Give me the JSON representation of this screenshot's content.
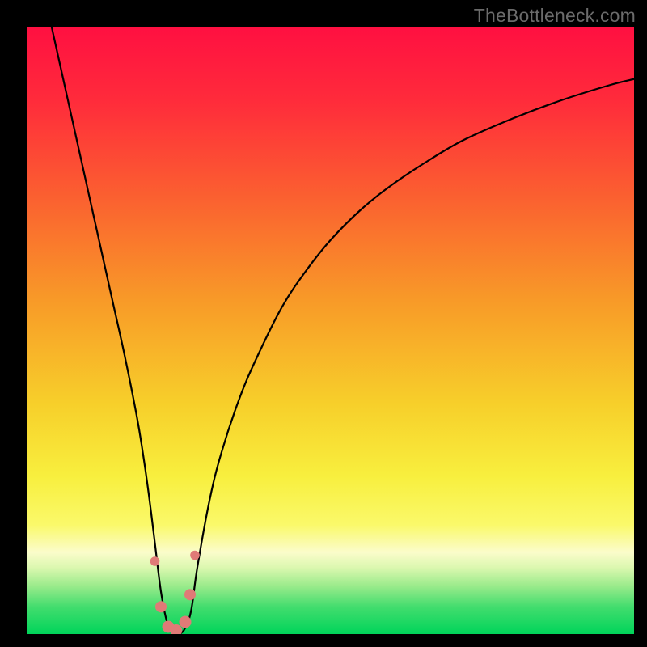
{
  "watermark": "TheBottleneck.com",
  "colors": {
    "frame": "#000000",
    "curve": "#000000",
    "marker_fill": "#e07a77",
    "marker_stroke": "#c45e5b",
    "gradient_stops": [
      {
        "offset": 0.0,
        "color": "#ff1041"
      },
      {
        "offset": 0.12,
        "color": "#ff2b3b"
      },
      {
        "offset": 0.28,
        "color": "#fb6030"
      },
      {
        "offset": 0.45,
        "color": "#f89a28"
      },
      {
        "offset": 0.62,
        "color": "#f7cf2a"
      },
      {
        "offset": 0.74,
        "color": "#f8ef3e"
      },
      {
        "offset": 0.82,
        "color": "#faf96a"
      },
      {
        "offset": 0.865,
        "color": "#fbfccb"
      },
      {
        "offset": 0.89,
        "color": "#dcf8b0"
      },
      {
        "offset": 0.92,
        "color": "#9ceb8c"
      },
      {
        "offset": 0.955,
        "color": "#43dd6e"
      },
      {
        "offset": 1.0,
        "color": "#00d45a"
      }
    ]
  },
  "chart_data": {
    "type": "line",
    "title": "",
    "xlabel": "",
    "ylabel": "",
    "xlim": [
      0,
      100
    ],
    "ylim": [
      0,
      100
    ],
    "grid": false,
    "legend": false,
    "series": [
      {
        "name": "bottleneck-curve",
        "x": [
          4,
          6,
          8,
          10,
          12,
          14,
          16,
          18,
          19,
          20,
          21,
          22,
          23,
          24,
          25,
          26,
          27,
          28,
          30,
          32,
          35,
          38,
          42,
          46,
          50,
          55,
          60,
          66,
          72,
          80,
          88,
          96,
          100
        ],
        "y": [
          100,
          91,
          82,
          73,
          64,
          55,
          46,
          36,
          30,
          23,
          15,
          7,
          2,
          0,
          0,
          1,
          4,
          11,
          22,
          30,
          39,
          46,
          54,
          60,
          65,
          70,
          74,
          78,
          81.5,
          85,
          88,
          90.5,
          91.5
        ]
      }
    ],
    "markers": {
      "name": "highlight-points-near-minimum",
      "x": [
        21.0,
        22.0,
        23.2,
        24.5,
        26.0,
        26.8,
        27.6
      ],
      "y": [
        12.0,
        4.5,
        1.2,
        0.6,
        2.0,
        6.5,
        13.0
      ],
      "r": [
        5.8,
        7.0,
        7.5,
        7.5,
        7.5,
        7.0,
        5.8
      ]
    }
  }
}
